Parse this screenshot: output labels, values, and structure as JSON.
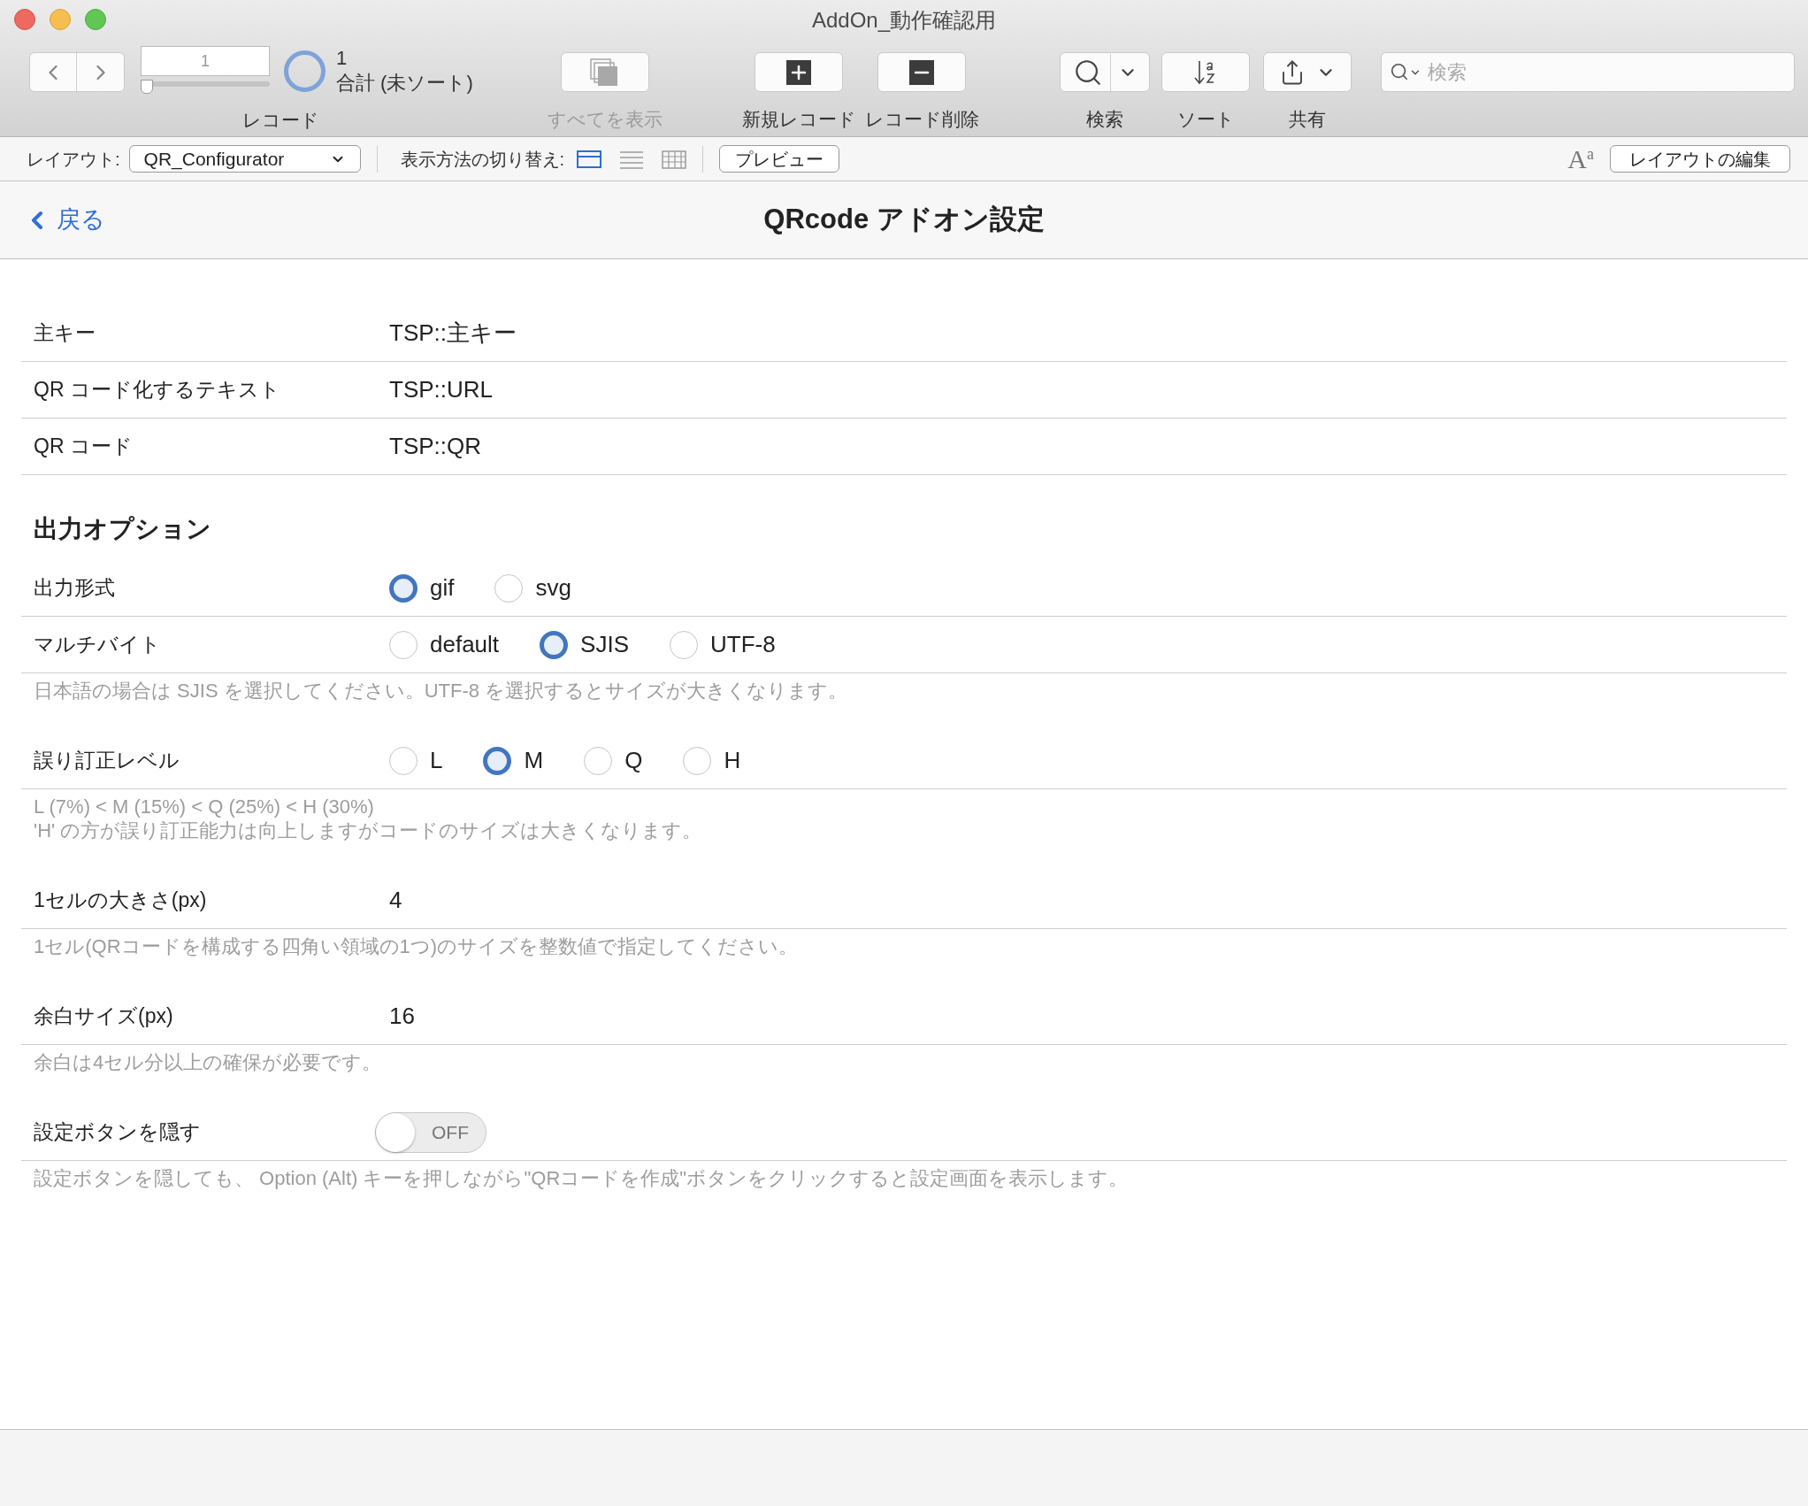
{
  "window": {
    "title": "AddOn_動作確認用"
  },
  "toolbar": {
    "record_field": "1",
    "record_slider": {
      "level": 0
    },
    "record_count": "1",
    "record_status": "合計 (未ソート)",
    "record_label": "レコード",
    "buttons": [
      {
        "kind": "show_all",
        "label": "すべてを表示",
        "disabled": true
      },
      {
        "kind": "new",
        "label": "新規レコード",
        "disabled": false
      },
      {
        "kind": "delete",
        "label": "レコード削除",
        "disabled": false
      },
      {
        "kind": "search",
        "label": "検索",
        "disabled": false
      },
      {
        "kind": "sort",
        "label": "ソート",
        "disabled": false
      },
      {
        "kind": "share",
        "label": "共有",
        "disabled": false
      }
    ],
    "search": {
      "placeholder": "検索"
    }
  },
  "layout_bar": {
    "layout_label": "レイアウト:",
    "layout_value": "QR_Configurator",
    "view_label": "表示方法の切り替え:",
    "views": [
      {
        "kind": "form",
        "selected": true
      },
      {
        "kind": "list",
        "selected": false
      },
      {
        "kind": "table",
        "selected": false
      }
    ],
    "preview": "プレビュー",
    "text_size": {
      "big": "A",
      "small": "a"
    },
    "edit_layout": "レイアウトの編集"
  },
  "header": {
    "back": "戻る",
    "title": "QRcode アドオン設定"
  },
  "fields": [
    {
      "label": "主キー",
      "value": "TSP::主キー"
    },
    {
      "label": "QR コード化するテキスト",
      "value": "TSP::URL"
    },
    {
      "label": "QR コード",
      "value": "TSP::QR"
    }
  ],
  "section_title": "出力オプション",
  "options": [
    {
      "kind": "radio",
      "label": "出力形式",
      "choices": [
        {
          "label": "gif",
          "selected": true
        },
        {
          "label": "svg",
          "selected": false
        }
      ]
    },
    {
      "kind": "radio",
      "label": "マルチバイト",
      "choices": [
        {
          "label": "default",
          "selected": false
        },
        {
          "label": "SJIS",
          "selected": true
        },
        {
          "label": "UTF-8",
          "selected": false
        }
      ],
      "note": [
        "日本語の場合は SJIS を選択してください。UTF-8 を選択するとサイズが大きくなります。"
      ]
    },
    {
      "kind": "radio",
      "label": "誤り訂正レベル",
      "choices": [
        {
          "label": "L",
          "selected": false
        },
        {
          "label": "M",
          "selected": true
        },
        {
          "label": "Q",
          "selected": false
        },
        {
          "label": "H",
          "selected": false
        }
      ],
      "note": [
        "L (7%) < M (15%) < Q (25%) < H (30%)",
        "'H' の方が誤り訂正能力は向上しますがコードのサイズは大きくなります。"
      ]
    },
    {
      "kind": "number",
      "label": "1セルの大きさ(px)",
      "value": "4",
      "note": [
        "1セル(QRコードを構成する四角い領域の1つ)のサイズを整数値で指定してください。"
      ]
    },
    {
      "kind": "number",
      "label": "余白サイズ(px)",
      "value": "16",
      "note": [
        "余白は4セル分以上の確保が必要です。"
      ]
    },
    {
      "kind": "toggle",
      "label": "設定ボタンを隠す",
      "on": false,
      "state_text": "OFF",
      "note": [
        "設定ボタンを隠しても、 Option (Alt) キーを押しながら\"QRコードを作成\"ボタンをクリックすると設定画面を表示します。"
      ]
    }
  ]
}
